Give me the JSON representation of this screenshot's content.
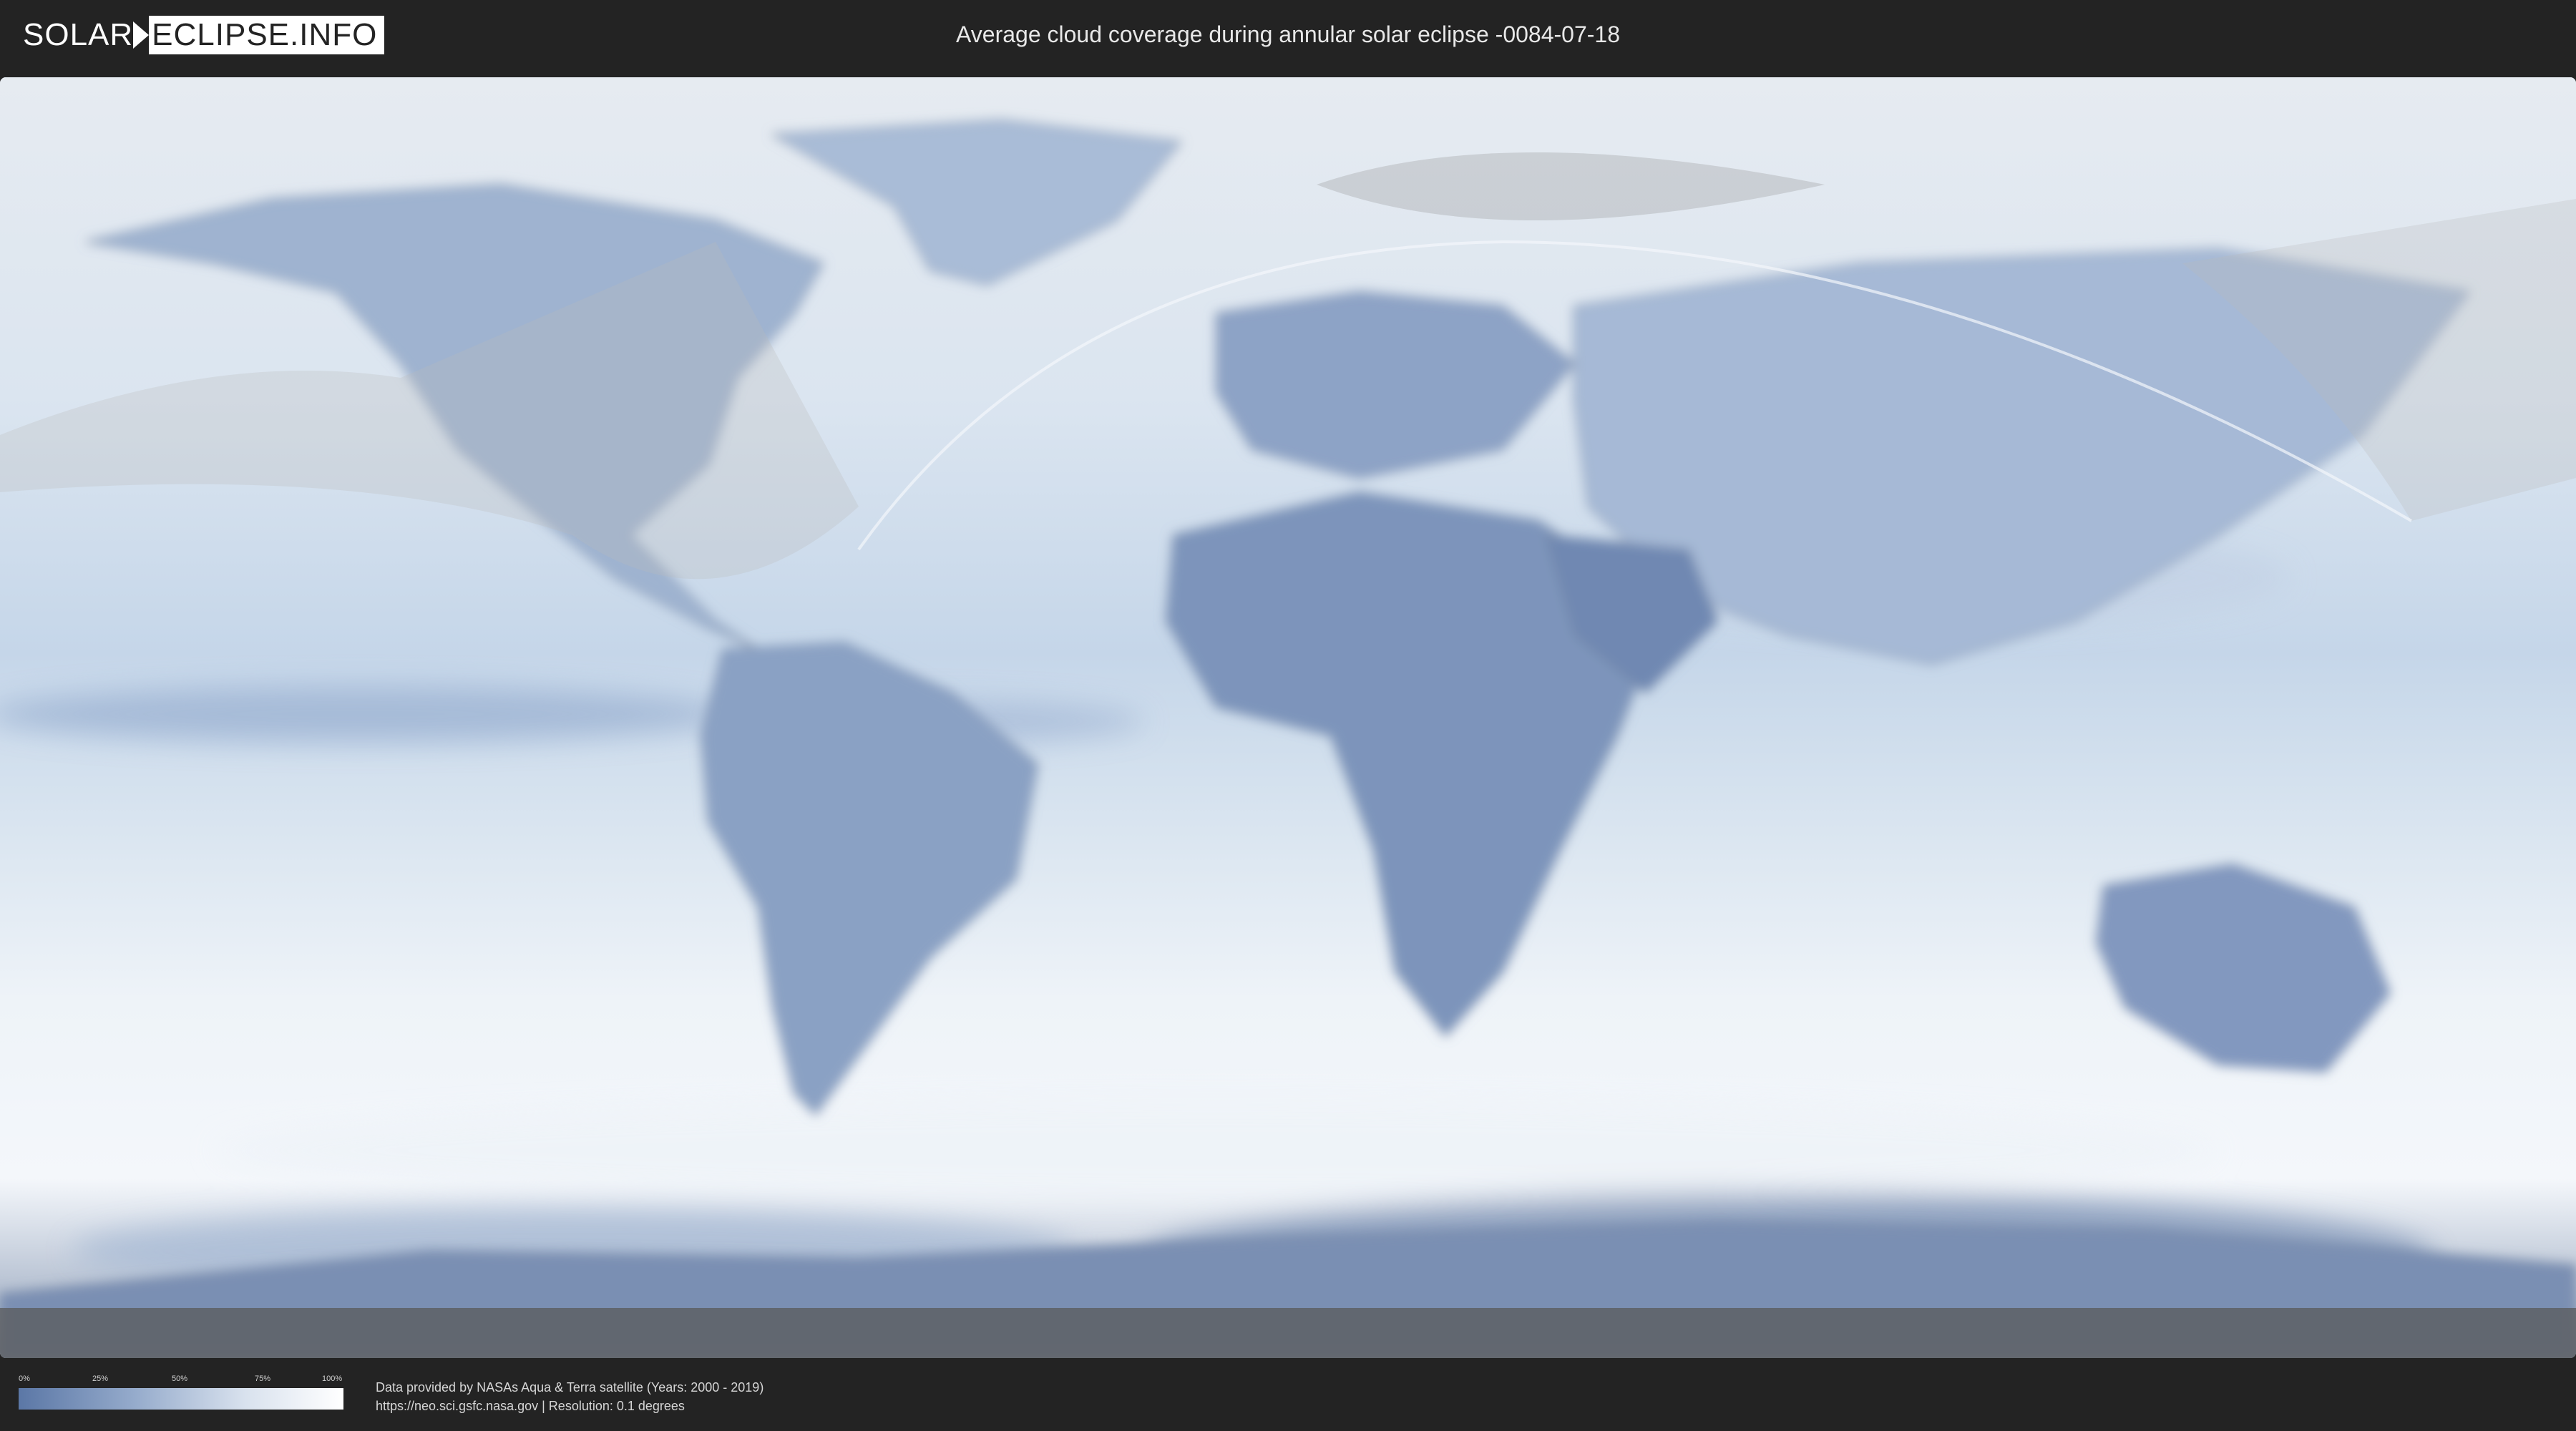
{
  "header": {
    "logo_left": "SOLAR",
    "logo_right": "ECLIPSE.INFO",
    "title": "Average cloud coverage during annular solar eclipse -0084-07-18"
  },
  "map": {
    "ocean_color": "#dfe8f2",
    "cloud_clear_color": "#5b77a6",
    "cloud_full_color": "#ffffff",
    "land_border_color": "#8a97a8",
    "eclipse_overlay_color": "#9a9a9a"
  },
  "legend": {
    "ticks": [
      "0%",
      "25%",
      "50%",
      "75%",
      "100%"
    ]
  },
  "footer": {
    "credit_line1": "Data provided by NASAs Aqua & Terra satellite (Years: 2000 - 2019)",
    "credit_line2": "https://neo.sci.gsfc.nasa.gov | Resolution: 0.1 degrees"
  }
}
